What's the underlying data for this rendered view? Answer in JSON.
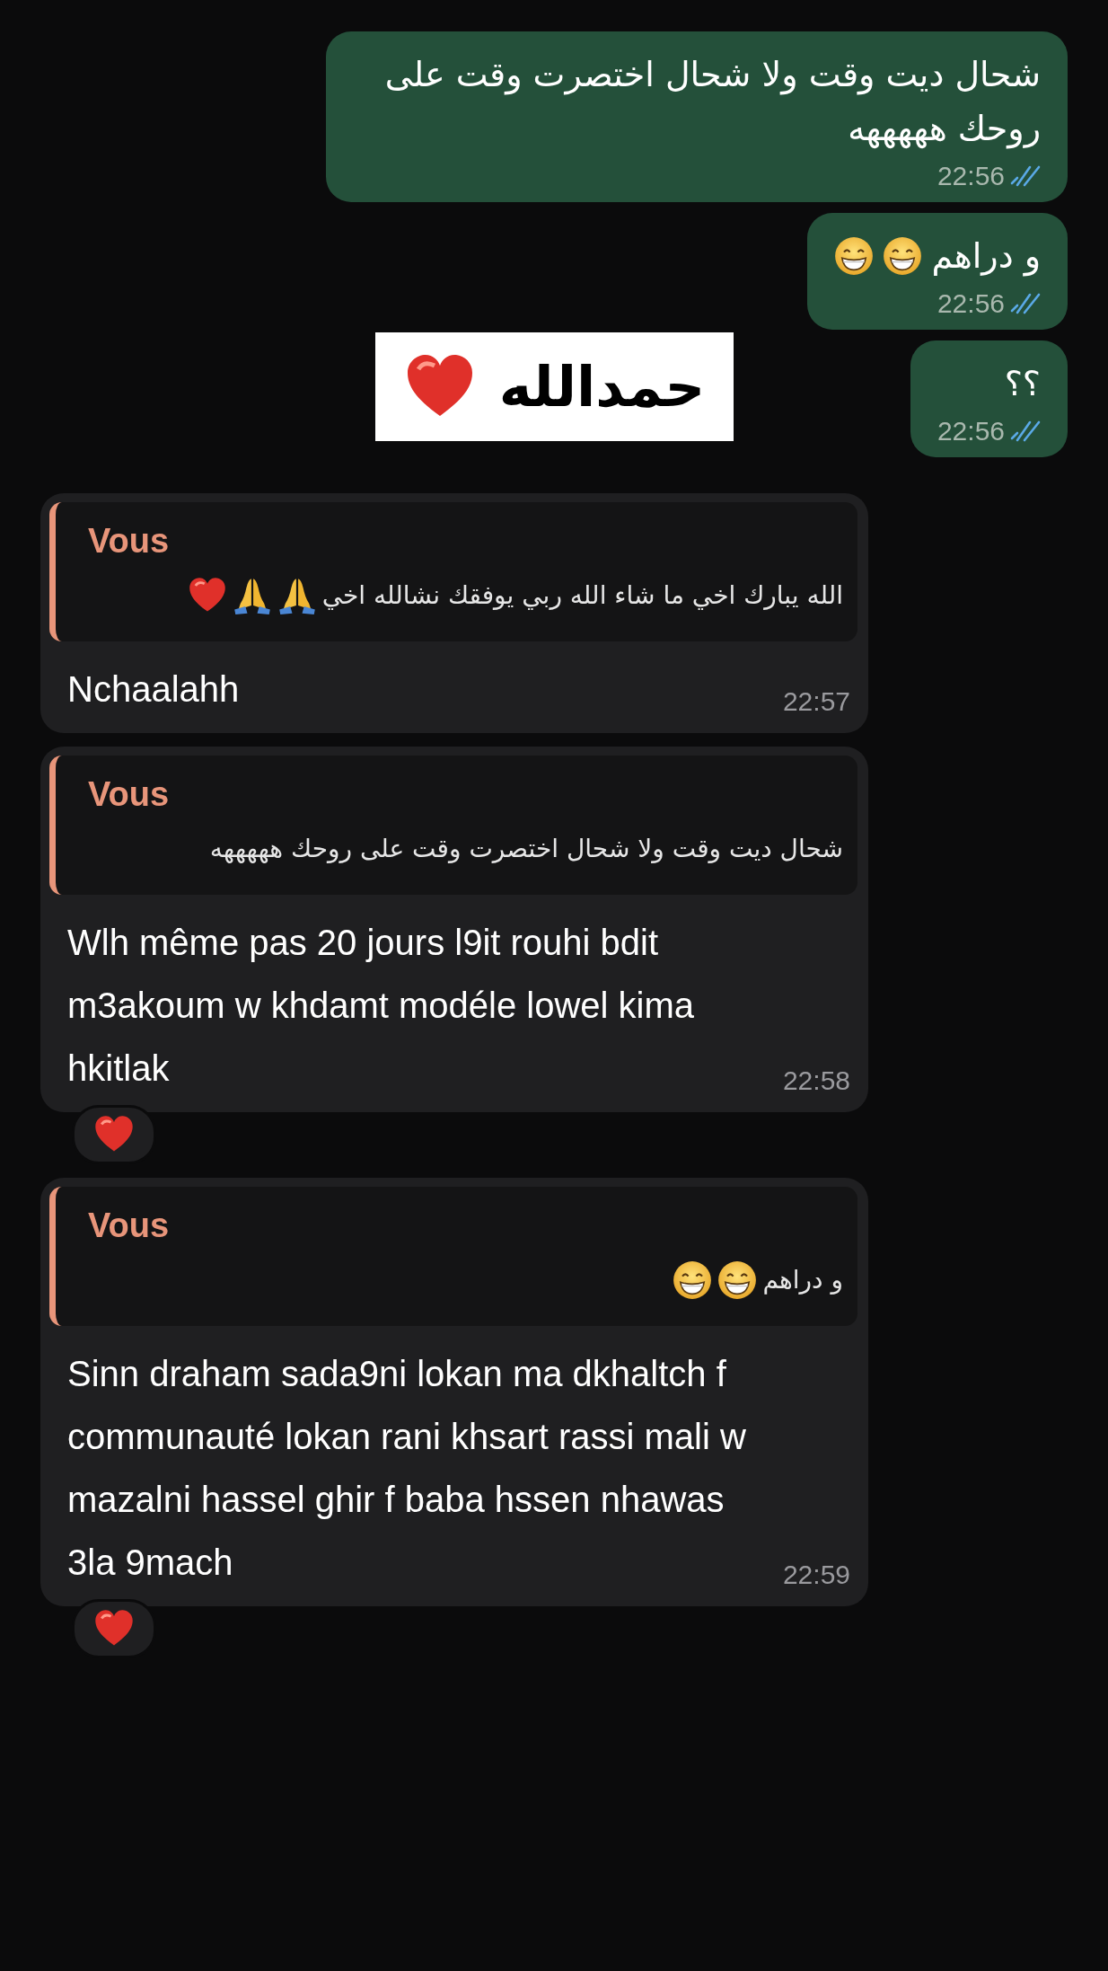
{
  "messages": [
    {
      "kind": "outgoing",
      "text": "شحال ديت وقت ولا شحال اختصرت وقت على روحك هههههه",
      "time": "22:56",
      "read": true
    },
    {
      "kind": "outgoing",
      "text": "و دراهم",
      "emoji": [
        {
          "kind": "grin"
        },
        {
          "kind": "grin"
        }
      ],
      "time": "22:56",
      "read": true
    },
    {
      "kind": "sticker",
      "text": "حمدالله",
      "emoji": [
        {
          "kind": "heart"
        }
      ]
    },
    {
      "kind": "outgoing",
      "text": "؟؟",
      "time": "22:56",
      "read": true
    },
    {
      "kind": "reply",
      "quote": {
        "author": "Vous",
        "text": "الله يبارك اخي ما شاء الله ربي يوفقك نشالله اخي",
        "emoji": [
          {
            "kind": "pray"
          },
          {
            "kind": "pray"
          },
          {
            "kind": "heart"
          }
        ]
      },
      "text": "Nchaalahh",
      "time": "22:57"
    },
    {
      "kind": "reply",
      "quote": {
        "author": "Vous",
        "text": "شحال ديت وقت ولا شحال اختصرت وقت على روحك هههههه"
      },
      "text": "Wlh même pas 20 jours l9it rouhi bdit m3akoum w khdamt modéle lowel kima hkitlak",
      "time": "22:58",
      "reaction": {
        "kind": "heart"
      }
    },
    {
      "kind": "reply",
      "quote": {
        "author": "Vous",
        "text": "و دراهم",
        "emoji": [
          {
            "kind": "grin"
          },
          {
            "kind": "grin"
          }
        ]
      },
      "text": "Sinn draham sada9ni lokan ma dkhaltch f communauté lokan rani khsart rassi mali w mazalni hassel ghir f baba hssen nhawas 3la 9mach",
      "time": "22:59",
      "reaction": {
        "kind": "heart"
      }
    }
  ]
}
